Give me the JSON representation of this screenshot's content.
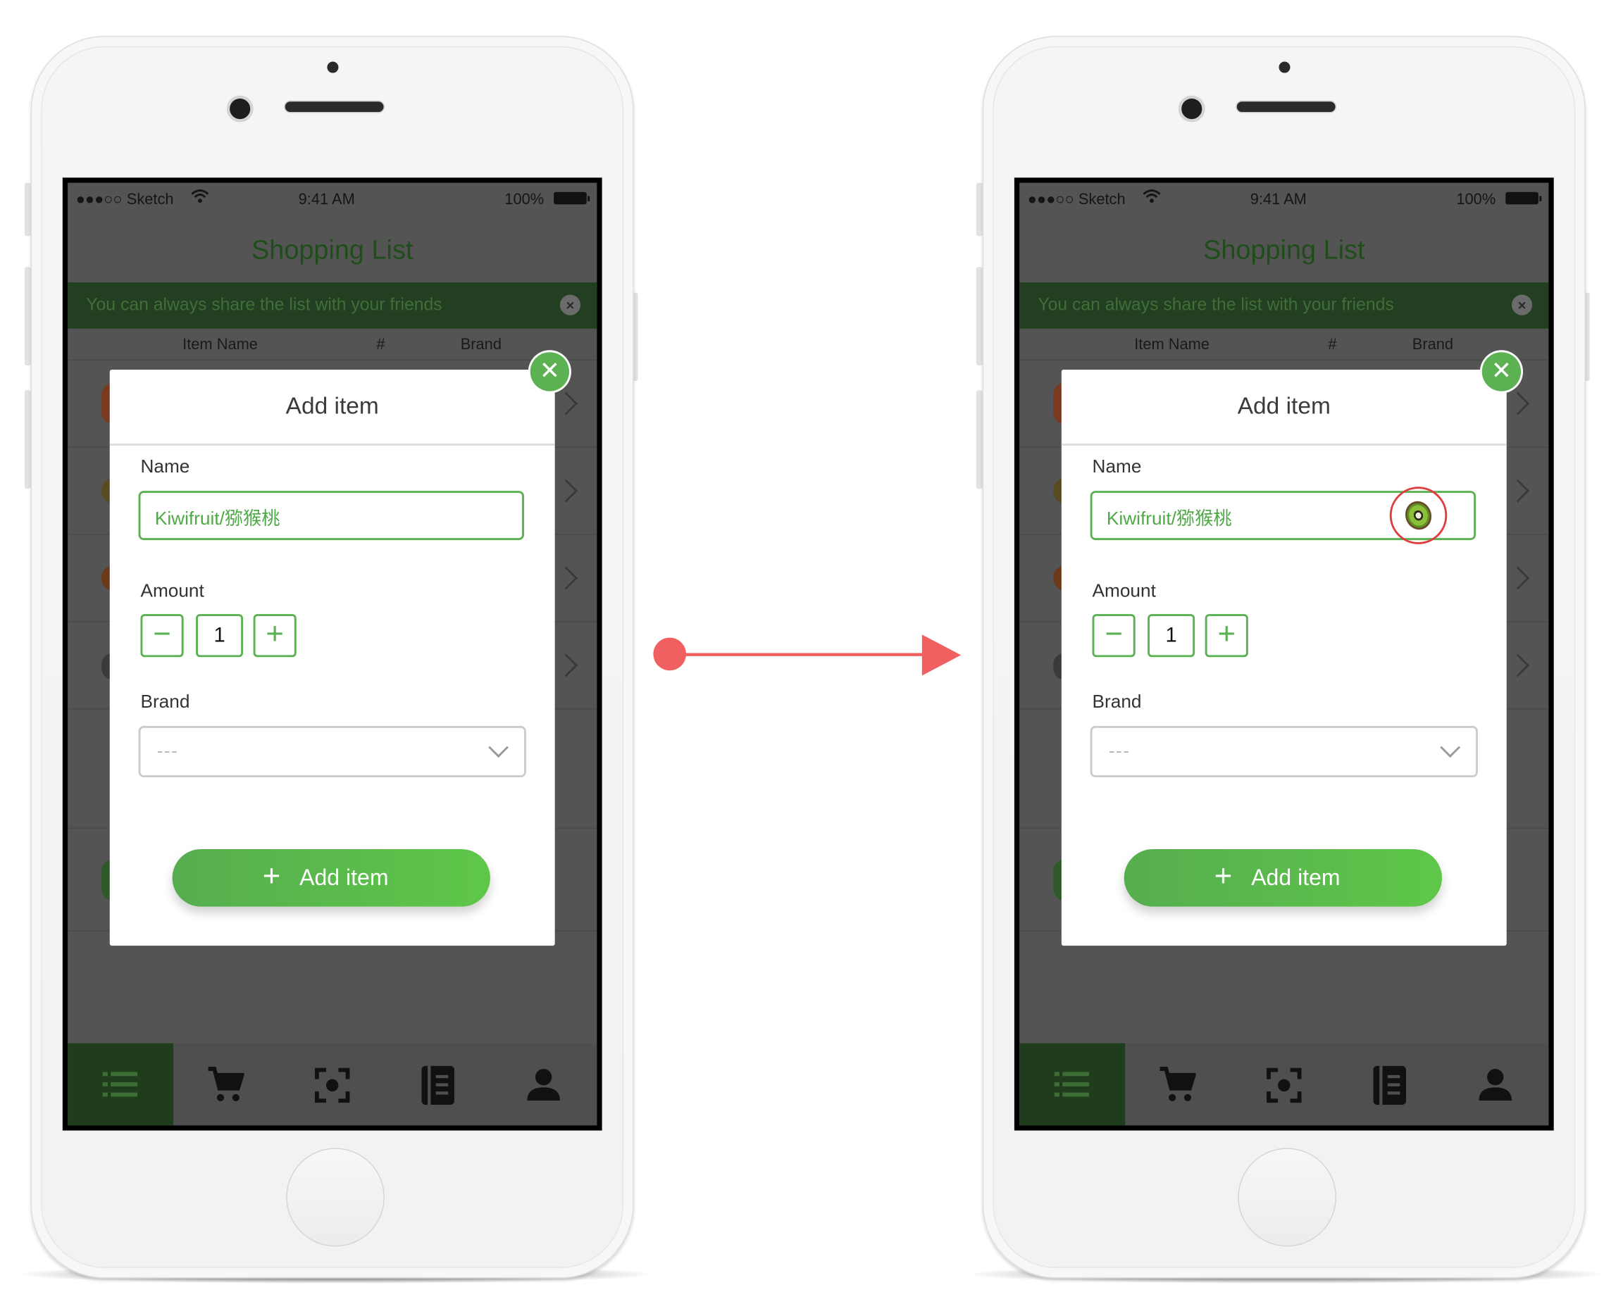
{
  "status_bar": {
    "carrier": "●●●○○ Sketch",
    "time": "9:41 AM",
    "battery": "100%"
  },
  "nav_title": "Shopping List",
  "banner_text": "You can always share the list with your friends",
  "columns": {
    "item_name": "Item Name",
    "number": "#",
    "brand": "Brand"
  },
  "modal": {
    "title": "Add item",
    "name_label": "Name",
    "name_value": "Kiwifruit/猕猴桃",
    "amount_label": "Amount",
    "amount_minus": "−",
    "amount_value": "1",
    "amount_plus": "+",
    "brand_label": "Brand",
    "brand_placeholder": "---",
    "add_button_label": "Add item",
    "close_symbol": "✕"
  },
  "tabs": [
    {
      "icon": "list-icon"
    },
    {
      "icon": "cart-icon"
    },
    {
      "icon": "scan-icon"
    },
    {
      "icon": "notebook-icon"
    },
    {
      "icon": "profile-icon"
    }
  ],
  "highlight_icon": "kiwi-icon",
  "colors": {
    "accent": "#5cb153",
    "arrow": "#f06060",
    "highlight": "#e03e3e",
    "dark_green": "#233f22"
  }
}
